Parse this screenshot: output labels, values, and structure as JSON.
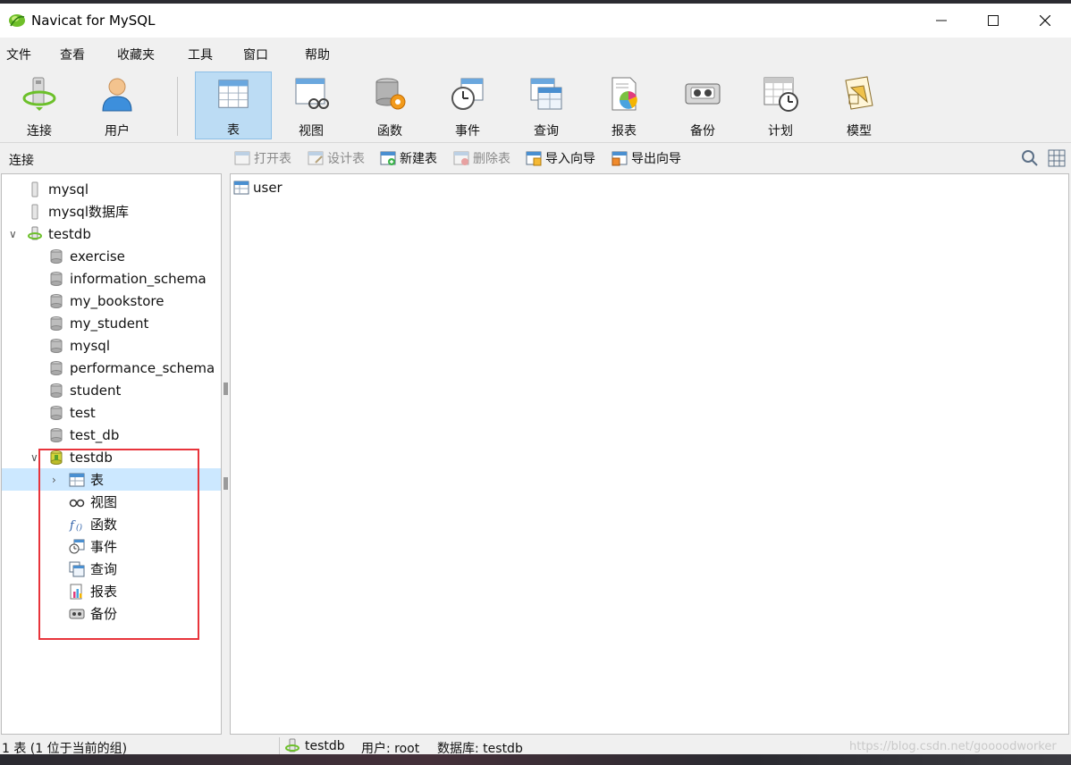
{
  "window": {
    "title": "Navicat for MySQL"
  },
  "menu": [
    "文件",
    "查看",
    "收藏夹",
    "工具",
    "窗口",
    "帮助"
  ],
  "toolbar": [
    {
      "label": "连接",
      "icon": "connection-icon"
    },
    {
      "label": "用户",
      "icon": "user-icon"
    },
    {
      "label": "表",
      "icon": "table-icon",
      "active": true
    },
    {
      "label": "视图",
      "icon": "view-icon"
    },
    {
      "label": "函数",
      "icon": "function-icon"
    },
    {
      "label": "事件",
      "icon": "event-icon"
    },
    {
      "label": "查询",
      "icon": "query-icon"
    },
    {
      "label": "报表",
      "icon": "report-icon"
    },
    {
      "label": "备份",
      "icon": "backup-icon"
    },
    {
      "label": "计划",
      "icon": "schedule-icon"
    },
    {
      "label": "模型",
      "icon": "model-icon"
    }
  ],
  "subbar": {
    "connection_label": "连接",
    "actions": [
      {
        "label": "打开表",
        "enabled": false
      },
      {
        "label": "设计表",
        "enabled": false
      },
      {
        "label": "新建表",
        "enabled": true
      },
      {
        "label": "删除表",
        "enabled": false
      },
      {
        "label": "导入向导",
        "enabled": true
      },
      {
        "label": "导出向导",
        "enabled": true
      }
    ]
  },
  "tree": {
    "connections": [
      "mysql",
      "mysql数据库"
    ],
    "open_connection": "testdb",
    "databases": [
      "exercise",
      "information_schema",
      "my_bookstore",
      "my_student",
      "mysql",
      "performance_schema",
      "student",
      "test",
      "test_db"
    ],
    "open_database": "testdb",
    "objects": [
      "表",
      "视图",
      "函数",
      "事件",
      "查询",
      "报表",
      "备份"
    ]
  },
  "objects_pane": {
    "items": [
      "user"
    ]
  },
  "status": {
    "count_text": "1 表 (1 位于当前的组)",
    "connection": "testdb",
    "user": "用户: root",
    "database": "数据库: testdb"
  },
  "watermark": "https://blog.csdn.net/goooodworker",
  "colors": {
    "selection": "#cce8ff",
    "highlight_box": "#e8343b",
    "active_tool": "#bcdcf4"
  }
}
